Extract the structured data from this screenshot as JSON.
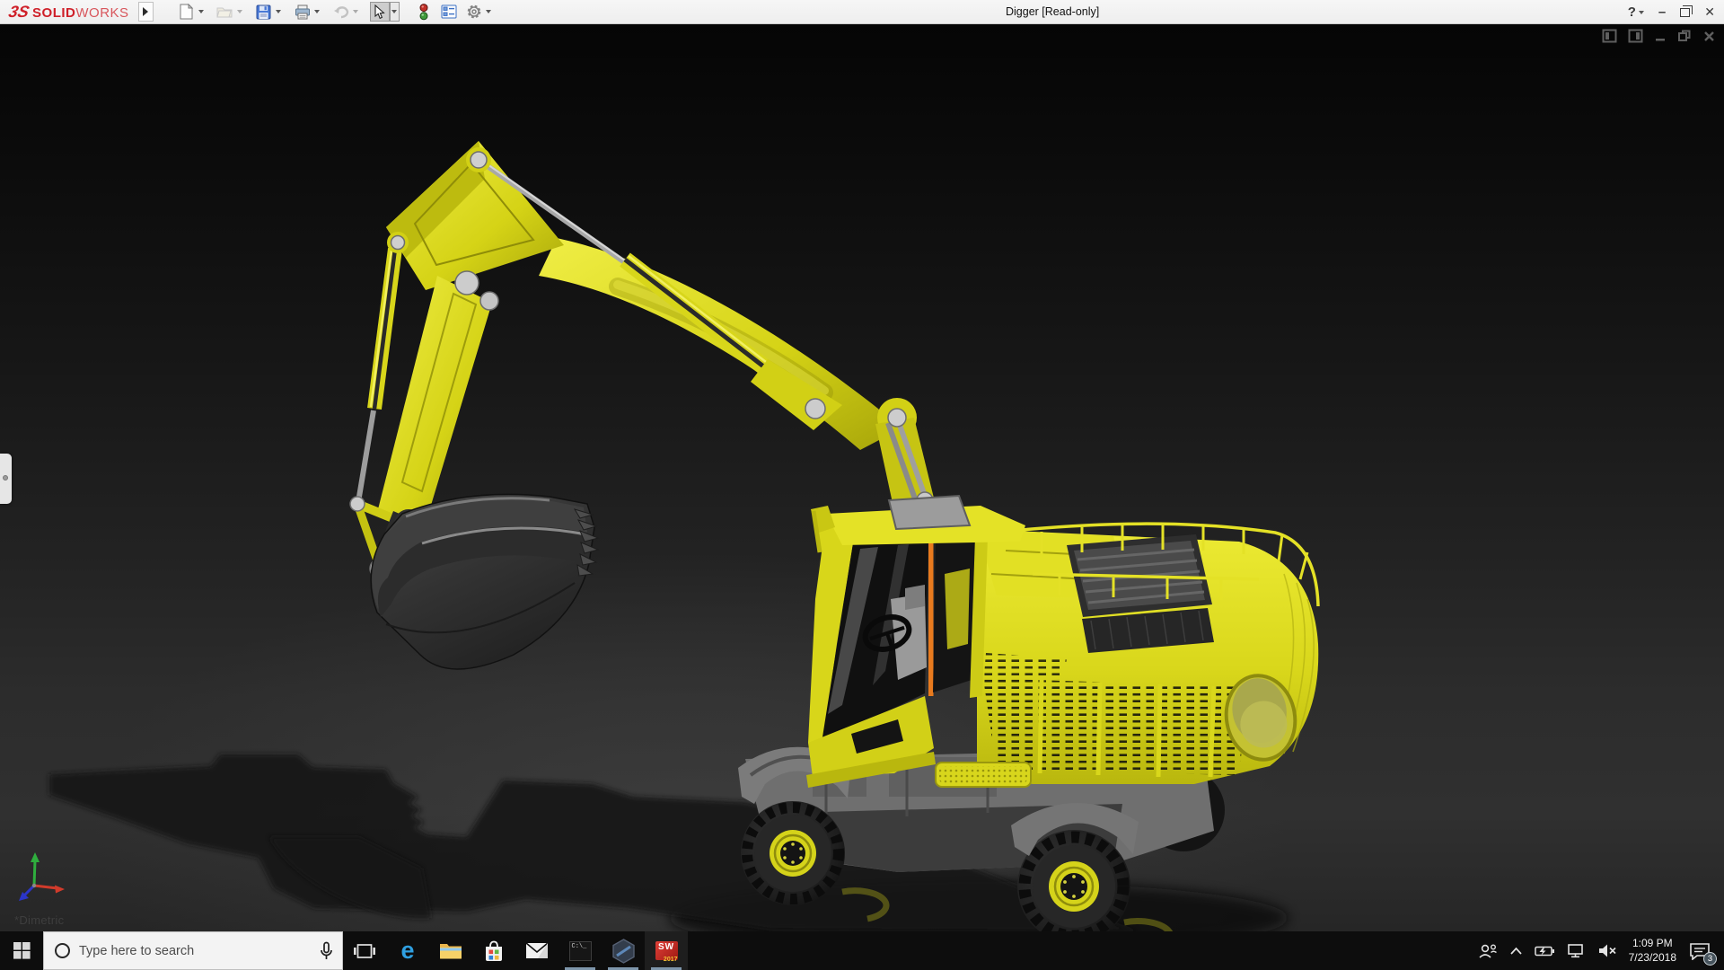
{
  "titlebar": {
    "brand": {
      "glyph": "3S",
      "bold": "SOLID",
      "light": "WORKS"
    },
    "document_title": "Digger [Read-only]",
    "toolbar_icons": [
      "new-document",
      "open",
      "save",
      "print",
      "undo",
      "select-cursor",
      "rebuild-traffic-light",
      "display-pane",
      "options-gear"
    ],
    "controls": {
      "help": "?",
      "minimize": "–",
      "close": "✕"
    }
  },
  "viewport": {
    "orientation_label": "*Dimetric",
    "document_window_controls": [
      "show-pane-left",
      "show-pane-right",
      "minimize",
      "restore",
      "close"
    ],
    "triad_axis_colors": {
      "x_red": "#d13b2b",
      "y_green": "#2fae3e",
      "z_blue": "#2b35c8"
    },
    "model": {
      "subject": "wheeled excavator digger",
      "paint_color": "#d9d71b",
      "selected_edge_color": "#e87a1e"
    }
  },
  "taskbar": {
    "search": {
      "placeholder": "Type here to search"
    },
    "apps": [
      {
        "id": "task-view",
        "running": false
      },
      {
        "id": "edge",
        "running": false,
        "glyph": "e"
      },
      {
        "id": "file-explorer",
        "running": false
      },
      {
        "id": "store",
        "running": false
      },
      {
        "id": "mail",
        "running": false
      },
      {
        "id": "command-prompt",
        "running": true,
        "glyph": "C:\\_"
      },
      {
        "id": "hexagon-app",
        "running": true
      },
      {
        "id": "solidworks-2017",
        "running": true,
        "letters": "SW",
        "year": "2017"
      }
    ],
    "tray": {
      "time": "1:09 PM",
      "date": "7/23/2018",
      "notification_badge": "3"
    }
  },
  "colors": {
    "titlebar_bg": "#f1f1f1",
    "logo_red": "#cf2029",
    "taskbar_bg": "#0d0d0d",
    "running_indicator": "#7e96ab",
    "excavator_yellow": "#d9d71b"
  }
}
